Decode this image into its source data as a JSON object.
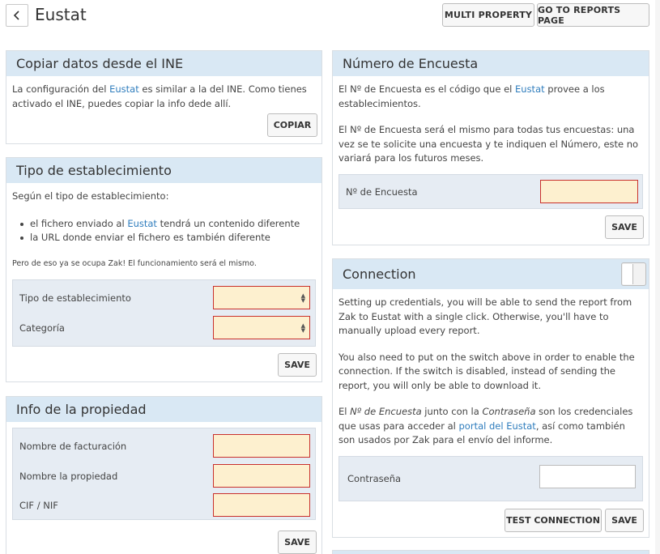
{
  "header": {
    "back_icon": "chevron-left-icon",
    "title": "Eustat",
    "multi_property": "MULTI PROPERTY",
    "go_to_reports": "GO TO REPORTS PAGE"
  },
  "copy_ine": {
    "title": "Copiar datos desde el INE",
    "text_before": "La configuración del ",
    "link": "Eustat",
    "text_after": " es similar a la del INE. Como tienes activado el INE, puedes copiar la info dede allí.",
    "button": "COPIAR"
  },
  "establishment": {
    "title": "Tipo de establecimiento",
    "intro": "Según el tipo de establecimiento:",
    "bullet1_before": "el fichero enviado al ",
    "bullet1_link": "Eustat",
    "bullet1_after": " tendrá un contenido diferente",
    "bullet2": "la URL donde enviar el fichero es también diferente",
    "note": "Pero de eso ya se ocupa Zak! El funcionamiento será el mismo.",
    "type_label": "Tipo de establecimiento",
    "type_value": "",
    "category_label": "Categoría",
    "category_value": "",
    "save": "SAVE"
  },
  "property": {
    "title": "Info de la propiedad",
    "billing_label": "Nombre de facturación",
    "billing_value": "",
    "name_label": "Nombre la propiedad",
    "name_value": "",
    "cif_label": "CIF / NIF",
    "cif_value": "",
    "save": "SAVE"
  },
  "survey": {
    "title": "Número de Encuesta",
    "p1_before": "El Nº de Encuesta es el código que el ",
    "p1_link": "Eustat",
    "p1_after": " provee a los establecimientos.",
    "p2": "El Nº de Encuesta será el mismo para todas tus encuestas: una vez se te solicite una encuesta y te indiquen el Número, este no variará para los futuros meses.",
    "field_label": "Nº de Encuesta",
    "field_value": "",
    "save": "SAVE"
  },
  "connection": {
    "title": "Connection",
    "p1": "Setting up credentials, you will be able to send the report from Zak to Eustat with a single click. Otherwise, you'll have to manually upload every report.",
    "p2": "You also need to put on the switch above in order to enable the connection. If the switch is disabled, instead of sending the report, you will only be able to download it.",
    "p3_a": "El ",
    "p3_em1": "Nº de Encuesta",
    "p3_b": " junto con la ",
    "p3_em2": "Contraseña",
    "p3_c": " son los credenciales que usas para acceder al ",
    "p3_link": "portal del Eustat",
    "p3_d": ", así como también son usados por Zak para el envío del informe.",
    "password_label": "Contraseña",
    "password_value": "",
    "test_connection": "TEST CONNECTION",
    "save": "SAVE",
    "switch_on": false
  }
}
